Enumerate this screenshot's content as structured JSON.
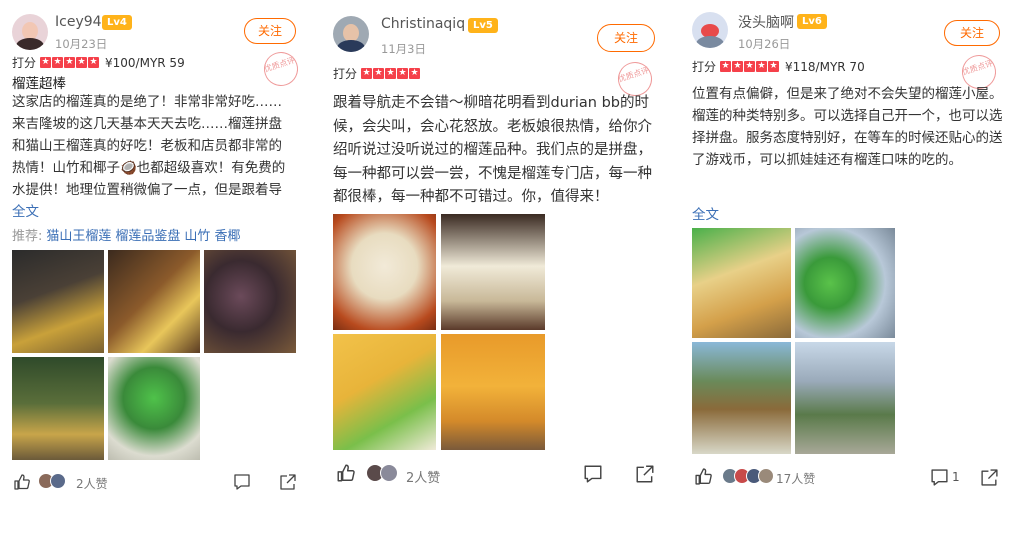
{
  "reviews": [
    {
      "username": "Icey94",
      "level": "Lv4",
      "date": "10月23日",
      "follow_label": "关注",
      "stamp_text": "优质点评",
      "rating_label": "打分",
      "price": "¥100/MYR 59",
      "title": "榴莲超棒",
      "text": "这家店的榴莲真的是绝了！非常非常好吃……来吉隆坡的这几天基本天天去吃……榴莲拼盘和猫山王榴莲真的好吃！老板和店员都非常的热情！山竹和椰子🥥也都超级喜欢！有免费的水提供！地理位置稍微偏了一点，但是跟着导航走也挺容易的！总…",
      "full_text_label": "全文",
      "recommend_label": "推荐:",
      "recommend_tags": [
        "猫山王榴莲",
        "榴莲品鉴盘",
        "山竹",
        "香椰"
      ],
      "likes_text": "2人赞",
      "comment_count": "",
      "icons": [
        "thumb-up-icon",
        "comment-icon",
        "share-icon"
      ]
    },
    {
      "username": "Christinaqiq",
      "level": "Lv5",
      "date": "11月3日",
      "follow_label": "关注",
      "stamp_text": "优质点评",
      "rating_label": "打分",
      "price": "",
      "title": "",
      "text": "跟着导航走不会错～柳暗花明看到durian bb的时候，会尖叫，会心花怒放。老板娘很热情，给你介绍听说过没听说过的榴莲品种。我们点的是拼盘，每一种都可以尝一尝，不愧是榴莲专门店，每一种都很棒，每一种都不可错过。你，值得来！",
      "full_text_label": "",
      "likes_text": "2人赞",
      "comment_count": "",
      "icons": [
        "thumb-up-icon",
        "comment-icon",
        "share-icon"
      ]
    },
    {
      "username": "没头脑啊",
      "level": "Lv6",
      "date": "10月26日",
      "follow_label": "关注",
      "stamp_text": "优质点评",
      "rating_label": "打分",
      "price": "¥118/MYR 70",
      "title": "",
      "text": "位置有点偏僻，但是来了绝对不会失望的榴莲小屋。榴莲的种类特别多。可以选择自己开一个，也可以选择拼盘。服务态度特别好，在等车的时候还贴心的送了游戏币，可以抓娃娃还有榴莲口味的吃的。",
      "full_text_label": "全文",
      "likes_text": "17人赞",
      "comment_count": "1",
      "icons": [
        "thumb-up-icon",
        "comment-icon",
        "share-icon"
      ]
    }
  ],
  "colors": {
    "accent_orange": "#ff6a00",
    "star_red": "#f5404a",
    "level_badge": "#ffb31a",
    "link_blue": "#3b6fb6",
    "stamp_pink": "#ef9a9a"
  }
}
